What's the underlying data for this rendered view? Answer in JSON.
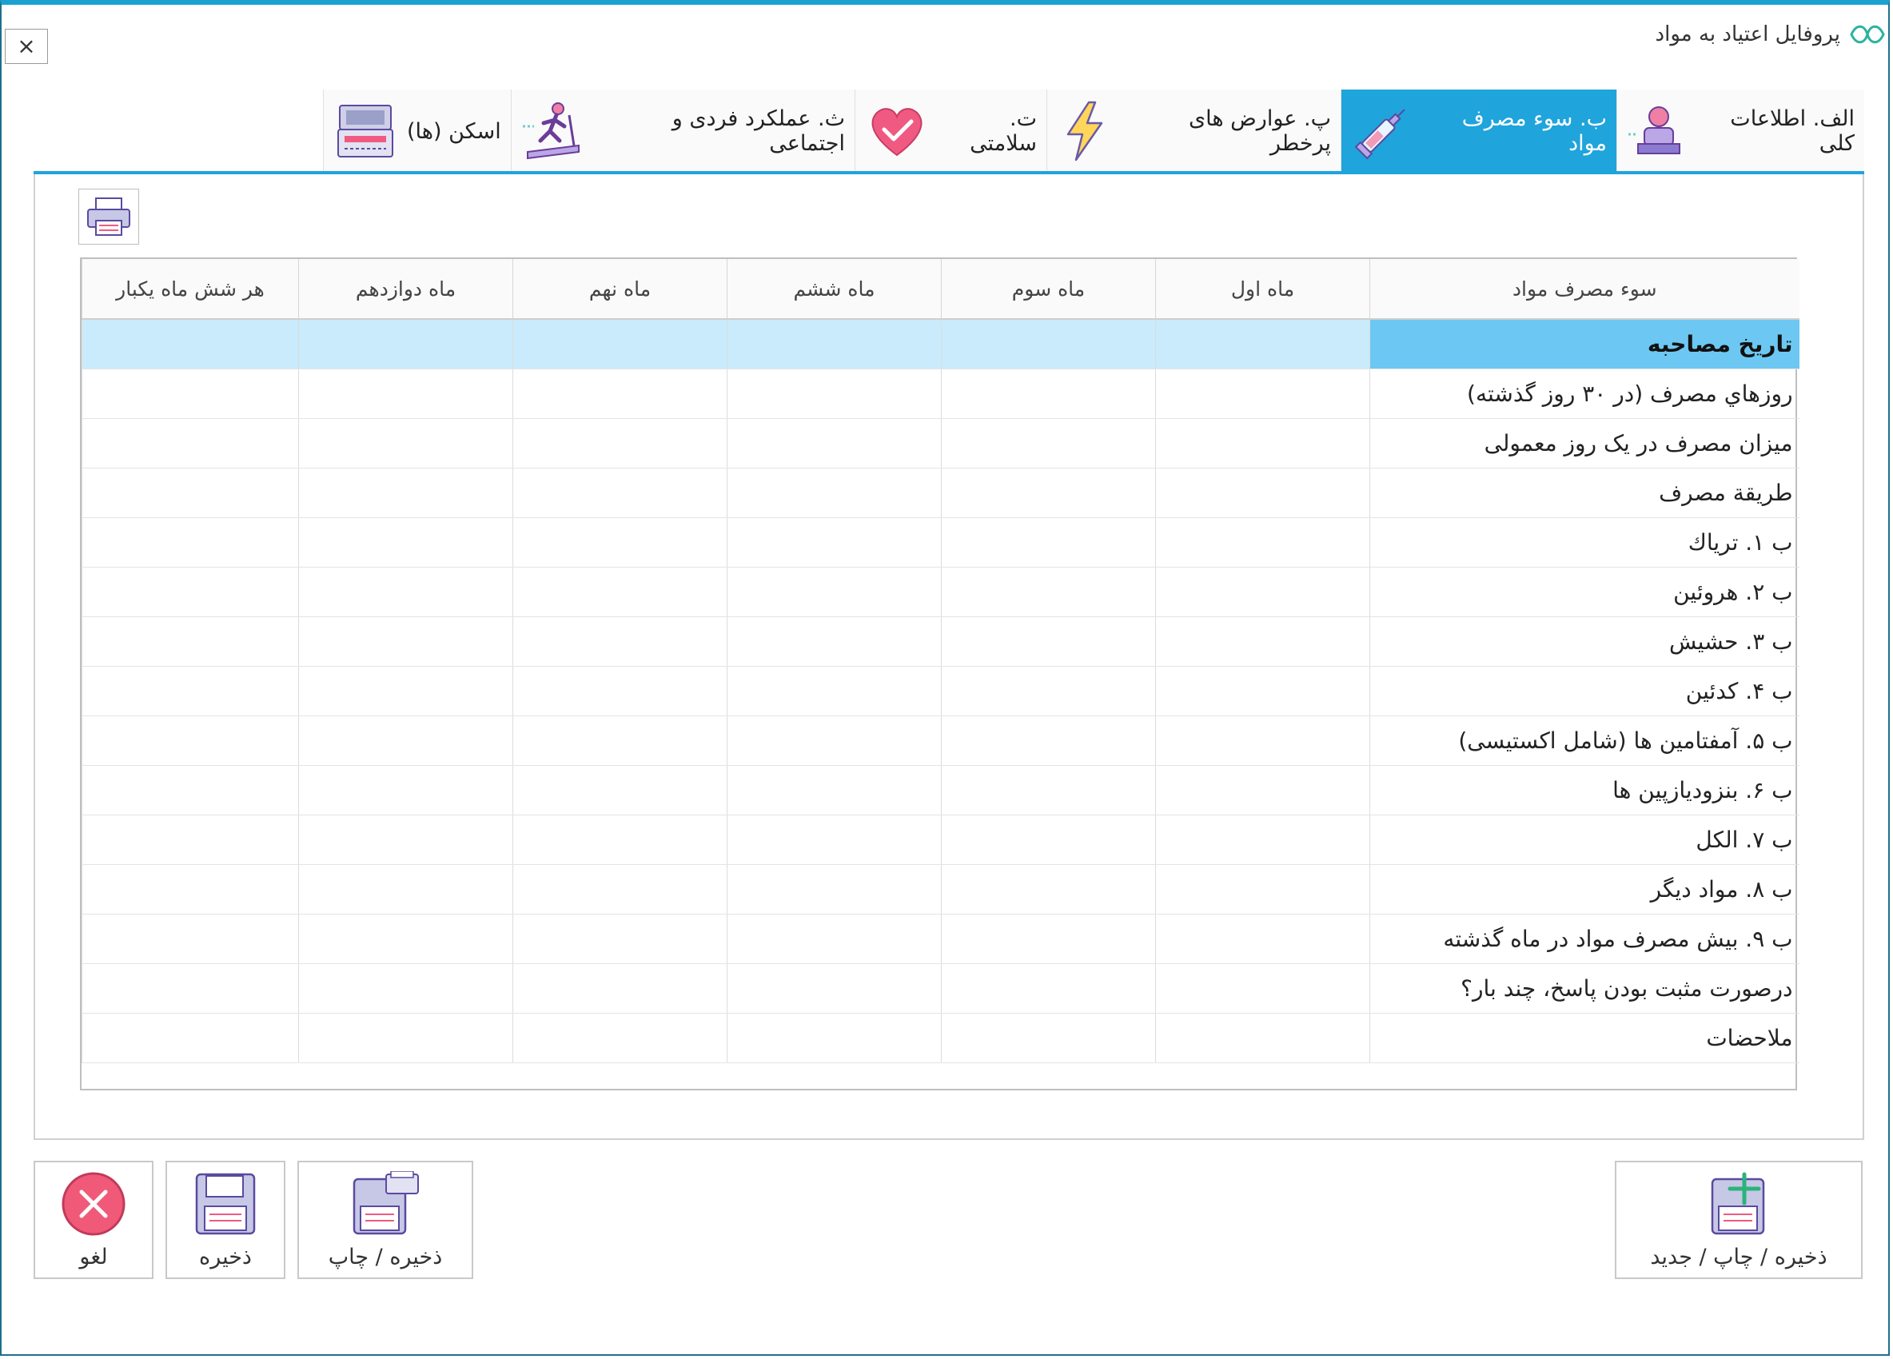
{
  "window": {
    "title": "پروفایل اعتیاد به مواد",
    "close_label": "×"
  },
  "tabs": [
    {
      "label": "الف. اطلاعات کلی",
      "icon": "person-desk-icon",
      "active": false
    },
    {
      "label": "ب. سوء مصرف مواد",
      "icon": "syringe-icon",
      "active": true
    },
    {
      "label": "پ. عوارض های پرخطر",
      "icon": "lightning-icon",
      "active": false
    },
    {
      "label": "ت. سلامتی",
      "icon": "heart-icon",
      "active": false
    },
    {
      "label": "ث. عملکرد فردی و اجتماعی",
      "icon": "treadmill-icon",
      "active": false
    },
    {
      "label": "اسکن (ها)",
      "icon": "scanner-icon",
      "active": false
    }
  ],
  "table": {
    "columns": [
      "سوء مصرف مواد",
      "ماه اول",
      "ماه سوم",
      "ماه ششم",
      "ماه نهم",
      "ماه دوازدهم",
      "هر شش ماه یکبار"
    ],
    "rows": [
      "تاریخ مصاحبه",
      "روزهاي  مصرف (در ۳۰ روز گذشته)",
      "میزان مصرف در یک روز معمولی",
      "طريقة مصرف",
      "ب ۱. ترياك",
      "ب ۲. هروئين",
      "ب ۳. حشيش",
      "ب ۴. كدئين",
      "ب ۵. آمفتامين ها (شامل اكستيسی)",
      "ب ۶. بنزوديازپين ها",
      "ب ۷. الكل",
      "ب ۸. مواد ديگر",
      "ب ۹. بیش مصرف مواد در ماه گذشته",
      "درصورت مثبت بودن پاسخ، چند بار؟",
      "ملاحضات"
    ],
    "selected_row": 0
  },
  "buttons": {
    "cancel": "لغو",
    "save": "ذخیره",
    "save_print": "ذخیره / چاپ",
    "save_print_new": "ذخیره / چاپ / جدید"
  },
  "colors": {
    "accent": "#1fa4dc",
    "selected_row": "#c9ebfb",
    "selected_cell": "#6cc8f2",
    "cancel_red": "#f05a78"
  }
}
